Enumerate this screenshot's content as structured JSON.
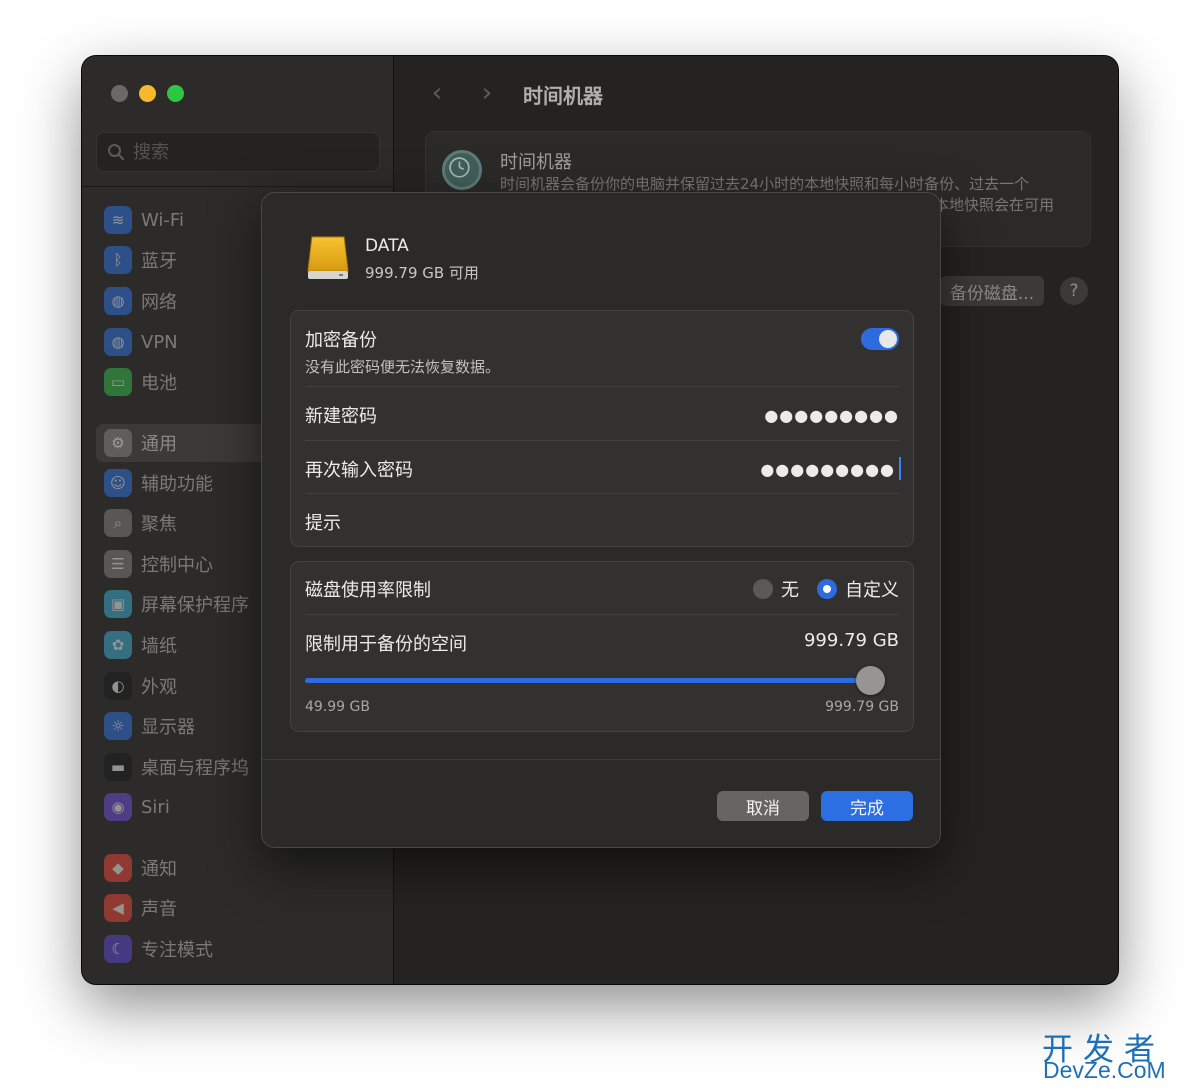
{
  "sidebar": {
    "search_placeholder": "搜索",
    "items": [
      {
        "label": "Wi-Fi",
        "icon": "wifi-icon",
        "color": "#2f6fd8"
      },
      {
        "label": "蓝牙",
        "icon": "bluetooth-icon",
        "color": "#2f6fd8"
      },
      {
        "label": "网络",
        "icon": "globe-icon",
        "color": "#2f6fd8"
      },
      {
        "label": "VPN",
        "icon": "vpn-globe-icon",
        "color": "#2f6fd8"
      },
      {
        "label": "电池",
        "icon": "battery-icon",
        "color": "#34b248"
      },
      {
        "label": "通用",
        "icon": "gear-icon",
        "color": "#7d7c7a"
      },
      {
        "label": "辅助功能",
        "icon": "accessibility-icon",
        "color": "#2f6fd8"
      },
      {
        "label": "聚焦",
        "icon": "spotlight-icon",
        "color": "#7d7c7a"
      },
      {
        "label": "控制中心",
        "icon": "control-center-icon",
        "color": "#7d7c7a"
      },
      {
        "label": "屏幕保护程序",
        "icon": "screensaver-icon",
        "color": "#3aa7c9"
      },
      {
        "label": "墙纸",
        "icon": "wallpaper-icon",
        "color": "#3aa7c9"
      },
      {
        "label": "外观",
        "icon": "appearance-icon",
        "color": "#1c1c1c"
      },
      {
        "label": "显示器",
        "icon": "display-icon",
        "color": "#2f6fd8"
      },
      {
        "label": "桌面与程序坞",
        "icon": "dock-icon",
        "color": "#1c1c1c"
      },
      {
        "label": "Siri",
        "icon": "siri-icon",
        "color": "#6b4ad0"
      },
      {
        "label": "通知",
        "icon": "notification-icon",
        "color": "#e0453a"
      },
      {
        "label": "声音",
        "icon": "sound-icon",
        "color": "#e0453a"
      },
      {
        "label": "专注模式",
        "icon": "moon-icon",
        "color": "#5a48c8"
      }
    ]
  },
  "content": {
    "title": "时间机器",
    "card_title": "时间机器",
    "card_desc": "时间机器会备份你的电脑并保留过去24小时的本地快照和每小时备份、过去一个",
    "card_desc2": "本地快照会在可用",
    "select_disk_label": "备份磁盘...",
    "help_label": "?"
  },
  "sheet": {
    "drive_name": "DATA",
    "drive_free": "999.79 GB 可用",
    "encrypt_label": "加密备份",
    "encrypt_sublabel": "没有此密码便无法恢复数据。",
    "encrypt_on": true,
    "new_password_label": "新建密码",
    "new_password_value": "●●●●●●●●●",
    "confirm_password_label": "再次输入密码",
    "confirm_password_value": "●●●●●●●●●",
    "hint_label": "提示",
    "disk_limit_label": "磁盘使用率限制",
    "option_none": "无",
    "option_custom": "自定义",
    "selected_option": "自定义",
    "limit_space_label": "限制用于备份的空间",
    "limit_value": "999.79 GB",
    "slider_min": "49.99 GB",
    "slider_max": "999.79 GB",
    "slider_fraction": 1.0,
    "cancel_label": "取消",
    "done_label": "完成"
  },
  "watermark": {
    "cn": "开发者",
    "en": "DevZe.CoM"
  },
  "colors": {
    "accent": "#2e6bde"
  }
}
